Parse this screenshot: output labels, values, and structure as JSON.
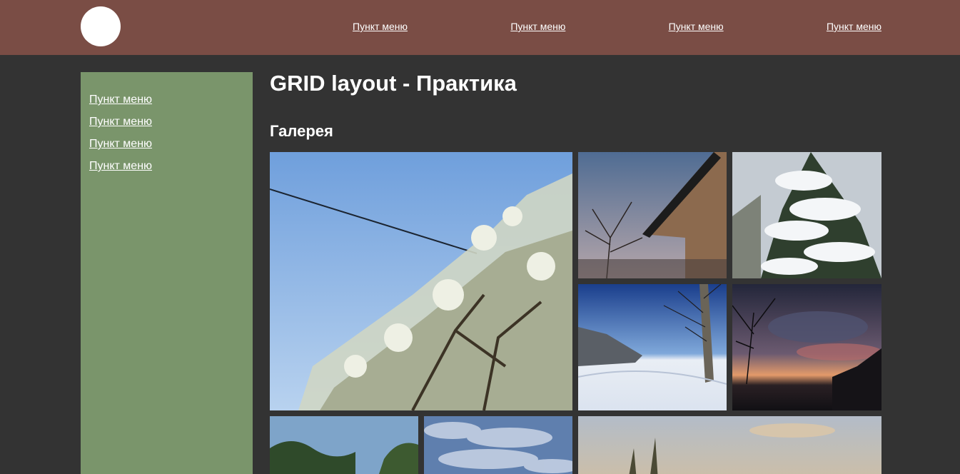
{
  "header": {
    "nav": [
      {
        "label": "Пункт меню"
      },
      {
        "label": "Пункт меню"
      },
      {
        "label": "Пункт меню"
      },
      {
        "label": "Пункт меню"
      }
    ]
  },
  "sidebar": {
    "items": [
      {
        "label": "Пункт меню"
      },
      {
        "label": "Пункт меню"
      },
      {
        "label": "Пункт меню"
      },
      {
        "label": "Пункт меню"
      }
    ]
  },
  "main": {
    "title": "GRID layout - Практика",
    "gallery_title": "Галерея"
  },
  "colors": {
    "header_bg": "#7a4d45",
    "sidebar_bg": "#7a956b",
    "page_bg": "#333333"
  }
}
